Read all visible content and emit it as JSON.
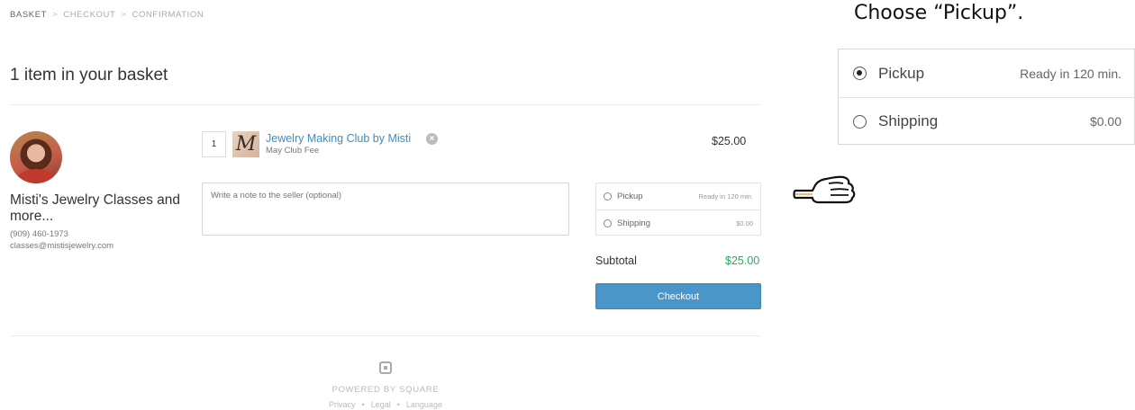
{
  "breadcrumb": {
    "step1": "BASKET",
    "step2": "CHECKOUT",
    "step3": "CONFIRMATION",
    "separator": ">"
  },
  "page_title": "1 item in your basket",
  "seller": {
    "name": "Misti's Jewelry Classes and more...",
    "phone": "(909) 460-1973",
    "email": "classes@mistisjewelry.com"
  },
  "item": {
    "quantity": "1",
    "thumb_letter": "M",
    "name": "Jewelry Making Club by Misti",
    "subtitle": "May Club Fee",
    "price": "$25.00"
  },
  "note": {
    "placeholder": "Write a note to the seller (optional)"
  },
  "fulfillment": {
    "pickup": {
      "label": "Pickup",
      "meta": "Ready in 120 min."
    },
    "shipping": {
      "label": "Shipping",
      "meta": "$0.00"
    }
  },
  "subtotal": {
    "label": "Subtotal",
    "value": "$25.00"
  },
  "checkout_label": "Checkout",
  "footer": {
    "powered": "POWERED BY SQUARE",
    "links": [
      "Privacy",
      "Legal",
      "Language"
    ]
  },
  "annotation": {
    "instruction": "Choose “Pickup”.",
    "zoom": {
      "pickup": {
        "label": "Pickup",
        "meta": "Ready in 120 min."
      },
      "shipping": {
        "label": "Shipping",
        "meta": "$0.00"
      },
      "selected": "pickup"
    }
  },
  "colors": {
    "link": "#3b8ec2",
    "accent_button": "#4a96c8",
    "subtotal_green": "#2eaa5f"
  },
  "icons": [
    "remove-icon",
    "square-logo-icon",
    "pointing-hand-icon",
    "radio-icon"
  ]
}
